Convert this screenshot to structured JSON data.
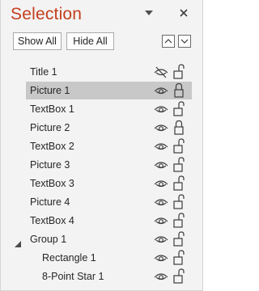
{
  "pane": {
    "title": "Selection",
    "show_all_label": "Show All",
    "hide_all_label": "Hide All"
  },
  "colors": {
    "title": "#c43e1c",
    "selected_row": "#c8c8c8"
  },
  "items": [
    {
      "label": "Title 1",
      "visibility_icon": "eye-slash-icon",
      "lock_icon": "unlock-icon",
      "level": 0,
      "selected": false
    },
    {
      "label": "Picture 1",
      "visibility_icon": "eye-icon",
      "lock_icon": "lock-icon",
      "level": 0,
      "selected": true
    },
    {
      "label": "TextBox 1",
      "visibility_icon": "eye-icon",
      "lock_icon": "unlock-icon",
      "level": 0,
      "selected": false
    },
    {
      "label": "Picture 2",
      "visibility_icon": "eye-icon",
      "lock_icon": "lock-icon",
      "level": 0,
      "selected": false
    },
    {
      "label": "TextBox 2",
      "visibility_icon": "eye-icon",
      "lock_icon": "unlock-icon",
      "level": 0,
      "selected": false
    },
    {
      "label": "Picture 3",
      "visibility_icon": "eye-icon",
      "lock_icon": "unlock-icon",
      "level": 0,
      "selected": false
    },
    {
      "label": "TextBox 3",
      "visibility_icon": "eye-icon",
      "lock_icon": "unlock-icon",
      "level": 0,
      "selected": false
    },
    {
      "label": "Picture 4",
      "visibility_icon": "eye-icon",
      "lock_icon": "unlock-icon",
      "level": 0,
      "selected": false
    },
    {
      "label": "TextBox 4",
      "visibility_icon": "eye-icon",
      "lock_icon": "unlock-icon",
      "level": 0,
      "selected": false
    },
    {
      "label": "Group 1",
      "visibility_icon": "eye-icon",
      "lock_icon": "unlock-icon",
      "level": 0,
      "selected": false,
      "expanded": true
    },
    {
      "label": "Rectangle 1",
      "visibility_icon": "eye-icon",
      "lock_icon": "unlock-icon",
      "level": 1,
      "selected": false
    },
    {
      "label": "8-Point Star 1",
      "visibility_icon": "eye-icon",
      "lock_icon": "unlock-icon",
      "level": 1,
      "selected": false
    }
  ]
}
